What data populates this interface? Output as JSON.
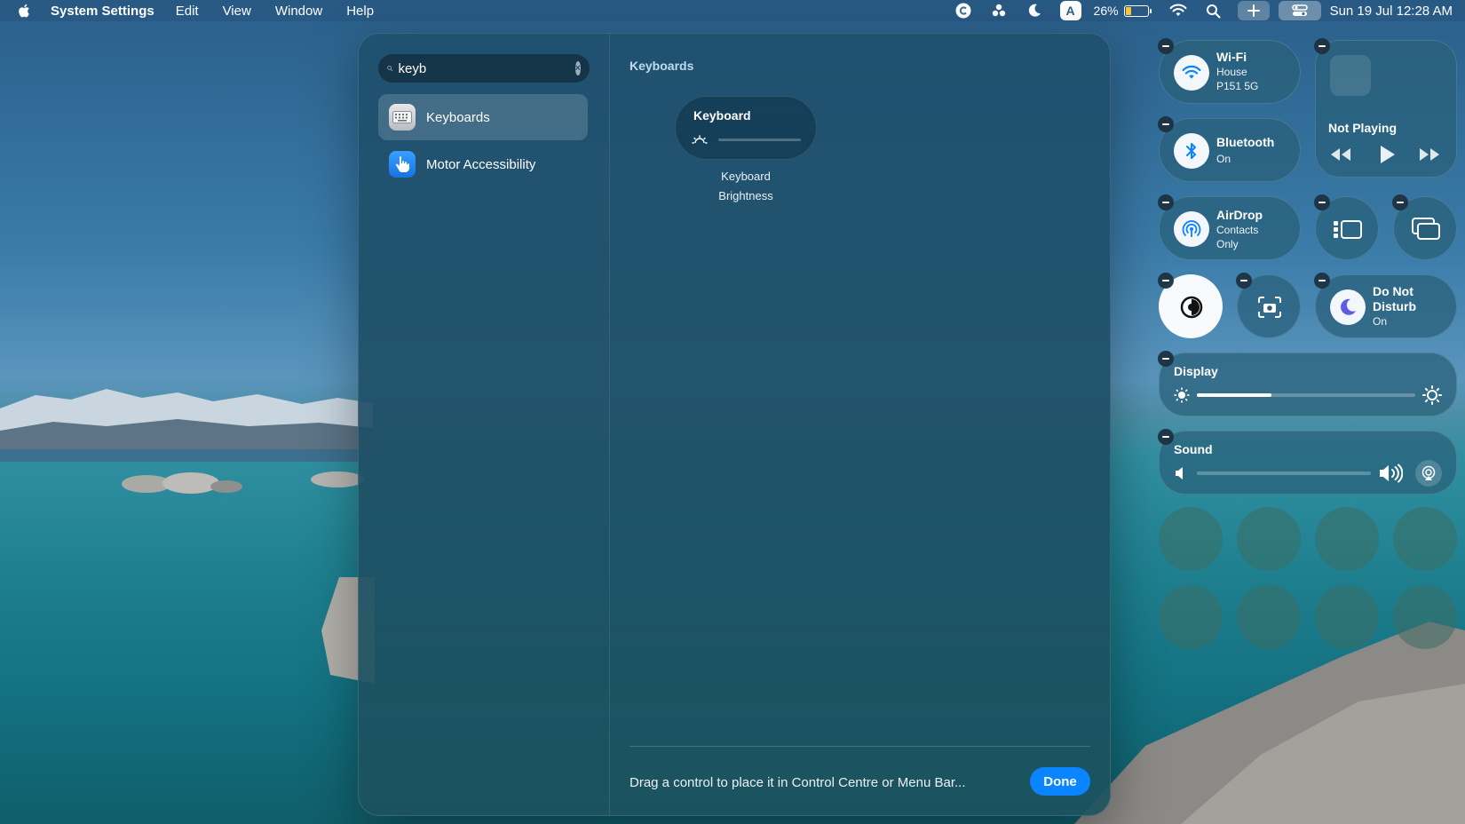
{
  "menubar": {
    "app_name": "System Settings",
    "menus": [
      "Edit",
      "View",
      "Window",
      "Help"
    ],
    "status_icons": [
      "c-circle-icon",
      "clover-icon",
      "moon-icon",
      "input-source-icon",
      "wifi-icon",
      "spotlight-icon",
      "plus-icon",
      "control-centre-icon"
    ],
    "input_source_letter": "A",
    "battery_percent": "26%",
    "battery_level": 0.26,
    "battery_color": "#f5c542",
    "datetime": "Sun 19 Jul  12:28 AM"
  },
  "sidebar": {
    "search_value": "keyb",
    "items": [
      {
        "label": "Keyboards",
        "icon": "keyboard-icon",
        "selected": true
      },
      {
        "label": "Motor Accessibility",
        "icon": "hand-pointer-icon",
        "selected": false
      }
    ]
  },
  "content": {
    "section_title": "Keyboards",
    "control": {
      "tile_title": "Keyboard",
      "caption_line1": "Keyboard",
      "caption_line2": "Brightness"
    },
    "footer_text": "Drag a control to place it in Control Centre or Menu Bar...",
    "done_label": "Done",
    "accent_color": "#0a84ff"
  },
  "control_centre": {
    "wifi": {
      "title": "Wi-Fi",
      "sub1": "House",
      "sub2": "P151 5G"
    },
    "now_playing": {
      "title": "Not Playing"
    },
    "bluetooth": {
      "title": "Bluetooth",
      "sub": "On"
    },
    "airdrop": {
      "title": "AirDrop",
      "sub1": "Contacts",
      "sub2": "Only"
    },
    "dnd": {
      "title": "Do Not",
      "title2": "Disturb",
      "sub": "On"
    },
    "display": {
      "title": "Display",
      "level": 0.34
    },
    "sound": {
      "title": "Sound",
      "level": 0.0
    }
  }
}
